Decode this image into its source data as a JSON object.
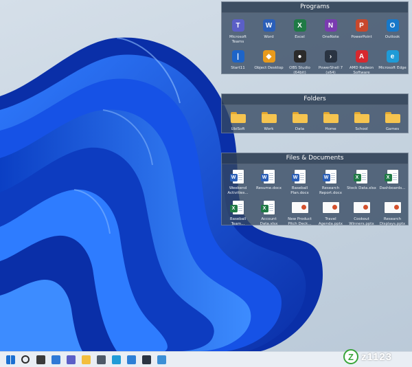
{
  "fences": [
    {
      "title": "Programs",
      "items": [
        {
          "label": "Microsoft Teams",
          "icon": "teams-icon",
          "color": "#5b5fc7",
          "glyph": "T"
        },
        {
          "label": "Word",
          "icon": "word-icon",
          "color": "#2b5fb8",
          "glyph": "W"
        },
        {
          "label": "Excel",
          "icon": "excel-icon",
          "color": "#1f7a45",
          "glyph": "X"
        },
        {
          "label": "OneNote",
          "icon": "onenote-icon",
          "color": "#7a3bb0",
          "glyph": "N"
        },
        {
          "label": "PowerPoint",
          "icon": "powerpoint-icon",
          "color": "#c8482c",
          "glyph": "P"
        },
        {
          "label": "Outlook",
          "icon": "outlook-icon",
          "color": "#1778c9",
          "glyph": "O"
        },
        {
          "label": "Start11",
          "icon": "start11-icon",
          "color": "#1d64c8",
          "glyph": "|"
        },
        {
          "label": "Object Desktop",
          "icon": "object-desktop-icon",
          "color": "#e89a1c",
          "glyph": "◆"
        },
        {
          "label": "OBS Studio (64bit)",
          "icon": "obs-icon",
          "color": "#2b2b2b",
          "glyph": "●"
        },
        {
          "label": "PowerShell 7 (x64)",
          "icon": "powershell-icon",
          "color": "#2a3442",
          "glyph": "›"
        },
        {
          "label": "AMD Radeon Software",
          "icon": "amd-radeon-icon",
          "color": "#d7282f",
          "glyph": "A"
        },
        {
          "label": "Microsoft Edge",
          "icon": "edge-icon",
          "color": "#1f9bd7",
          "glyph": "e"
        }
      ]
    },
    {
      "title": "Folders",
      "items": [
        {
          "label": "UbiSoft",
          "icon": "folder-icon"
        },
        {
          "label": "Work",
          "icon": "folder-icon"
        },
        {
          "label": "Data",
          "icon": "folder-icon"
        },
        {
          "label": "Home",
          "icon": "folder-icon"
        },
        {
          "label": "School",
          "icon": "folder-icon"
        },
        {
          "label": "Games",
          "icon": "folder-icon"
        }
      ]
    },
    {
      "title": "Files & Documents",
      "items": [
        {
          "label": "Weekend Activities...",
          "icon": "word-doc-icon",
          "kind": "word"
        },
        {
          "label": "Resume.docx",
          "icon": "word-doc-icon",
          "kind": "word"
        },
        {
          "label": "Baseball Plan.docx",
          "icon": "word-doc-icon",
          "kind": "word"
        },
        {
          "label": "Research Report.docx",
          "icon": "word-doc-icon",
          "kind": "word"
        },
        {
          "label": "Stock Data.xlsx",
          "icon": "excel-doc-icon",
          "kind": "excel"
        },
        {
          "label": "Dashboards...",
          "icon": "excel-doc-icon",
          "kind": "excel"
        },
        {
          "label": "Baseball Team...",
          "icon": "excel-doc-icon",
          "kind": "excel"
        },
        {
          "label": "Account Data.xlsx",
          "icon": "excel-doc-icon",
          "kind": "excel"
        },
        {
          "label": "New Product Pitch Deck...",
          "icon": "pptx-thumb-icon",
          "kind": "ppt"
        },
        {
          "label": "Travel Agenda.pptx",
          "icon": "pptx-thumb-icon",
          "kind": "ppt"
        },
        {
          "label": "Cookout Winners.pptx",
          "icon": "pptx-thumb-icon",
          "kind": "ppt"
        },
        {
          "label": "Research Displays.pptx",
          "icon": "pptx-thumb-icon",
          "kind": "ppt"
        }
      ]
    }
  ],
  "taskbar": {
    "icons": [
      {
        "name": "start-icon",
        "color": "#1a6fd1"
      },
      {
        "name": "search-icon",
        "color": "#2b2b2b"
      },
      {
        "name": "task-view-icon",
        "color": "#3a3a3a"
      },
      {
        "name": "widgets-icon",
        "color": "#2f79d6"
      },
      {
        "name": "chat-icon",
        "color": "#5b5fc7"
      },
      {
        "name": "file-explorer-icon",
        "color": "#f3be3e"
      },
      {
        "name": "camera-icon",
        "color": "#4d5968"
      },
      {
        "name": "edge-icon",
        "color": "#1f9bd7"
      },
      {
        "name": "store-icon",
        "color": "#2d7fd6"
      },
      {
        "name": "terminal-icon",
        "color": "#2a3442"
      },
      {
        "name": "globe-icon",
        "color": "#3b8fd6"
      }
    ]
  },
  "watermark": {
    "logo_letter": "Z",
    "text": "z1123"
  }
}
